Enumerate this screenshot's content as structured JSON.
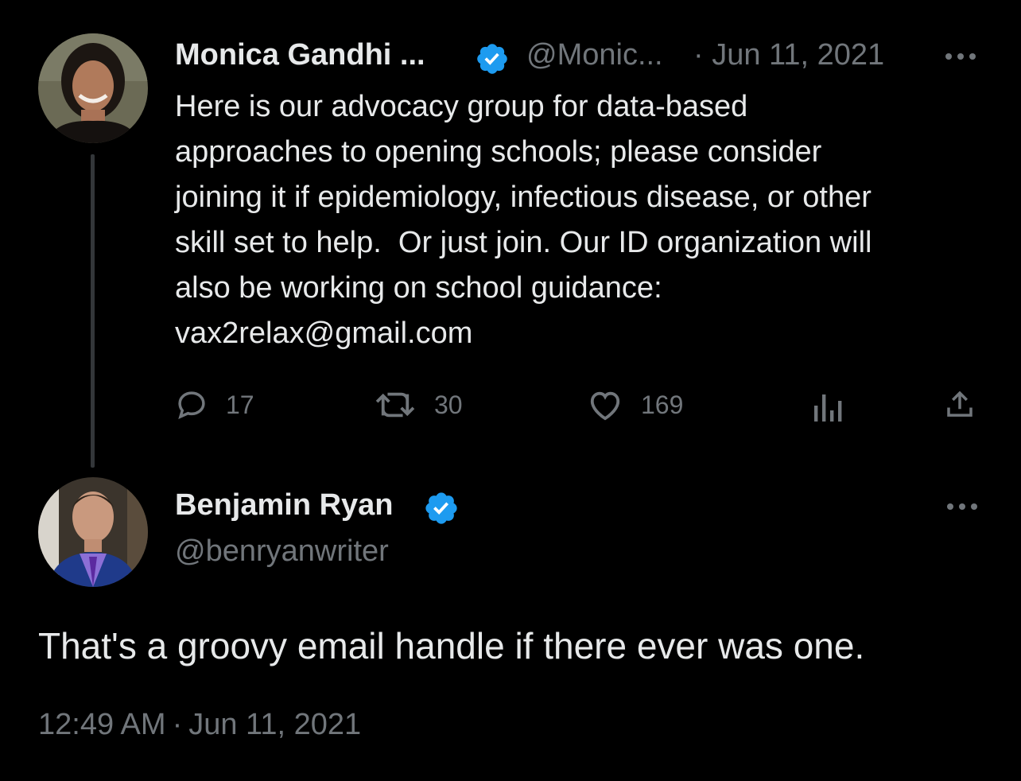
{
  "parent_tweet": {
    "author_name": "Monica Gandhi ...",
    "author_handle": "@Monic...",
    "date": "· Jun 11, 2021",
    "text": "Here is our advocacy group for data-based\napproaches to opening schools; please consider\njoining it if epidemiology, infectious disease, or other\nskill set to help.  Or just join. Our ID organization will\nalso be working on school guidance:\nvax2relax@gmail.com",
    "reply_count": "17",
    "retweet_count": "30",
    "like_count": "169",
    "icons": [
      "verified-badge-icon",
      "more-icon",
      "reply-icon",
      "retweet-icon",
      "like-icon",
      "views-icon",
      "share-icon"
    ]
  },
  "reply_tweet": {
    "author_name": "Benjamin Ryan",
    "author_handle": "@benryanwriter",
    "text": "That's a groovy email handle if there ever was one.",
    "time": "12:49 AM",
    "separator": "·",
    "date": "Jun 11, 2021",
    "icons": [
      "verified-badge-icon",
      "more-icon"
    ]
  },
  "colors": {
    "background": "#000000",
    "text_primary": "#e7e9ea",
    "text_muted": "#71767b",
    "verified_blue": "#1d9bf0",
    "thread_line": "#333639"
  }
}
